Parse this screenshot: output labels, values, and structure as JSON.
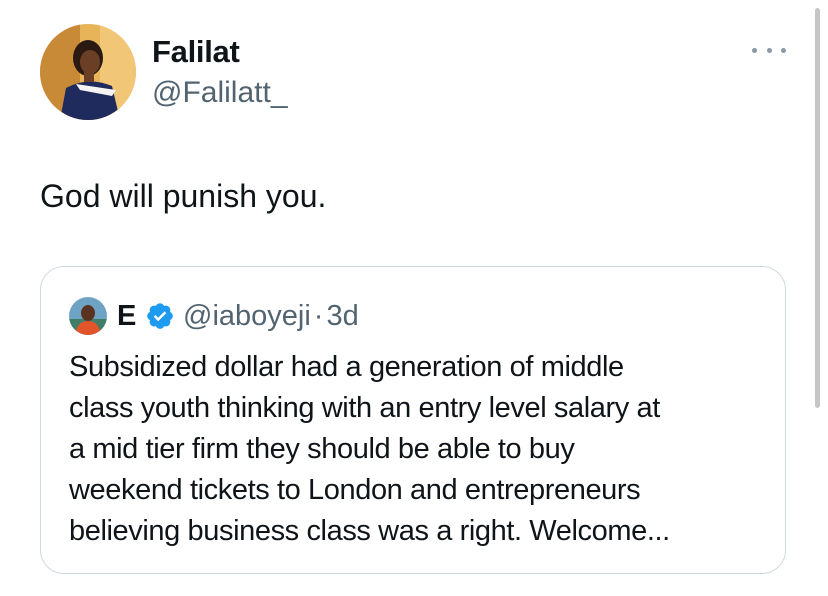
{
  "tweet": {
    "author": {
      "name": "Falilat",
      "handle": "@Falilatt_"
    },
    "text": "God will punish you.",
    "more_icon": "more-horizontal-icon"
  },
  "quoted_tweet": {
    "author": {
      "name": "E",
      "handle": "@iaboyeji",
      "separator": "·",
      "time": "3d"
    },
    "verified_icon": "verified-badge-icon",
    "text_lines": [
      "Subsidized dollar had a generation of middle",
      "class youth thinking with an entry level salary at",
      "a mid tier firm they should be able to buy",
      "weekend tickets to London and entrepreneurs",
      "believing business class was a right. Welcome..."
    ]
  },
  "colors": {
    "text": "#0f1419",
    "secondary": "#536471",
    "border": "#cfd9de",
    "verified": "#1d9bf0",
    "scrollbar": "#c6c6c6"
  }
}
